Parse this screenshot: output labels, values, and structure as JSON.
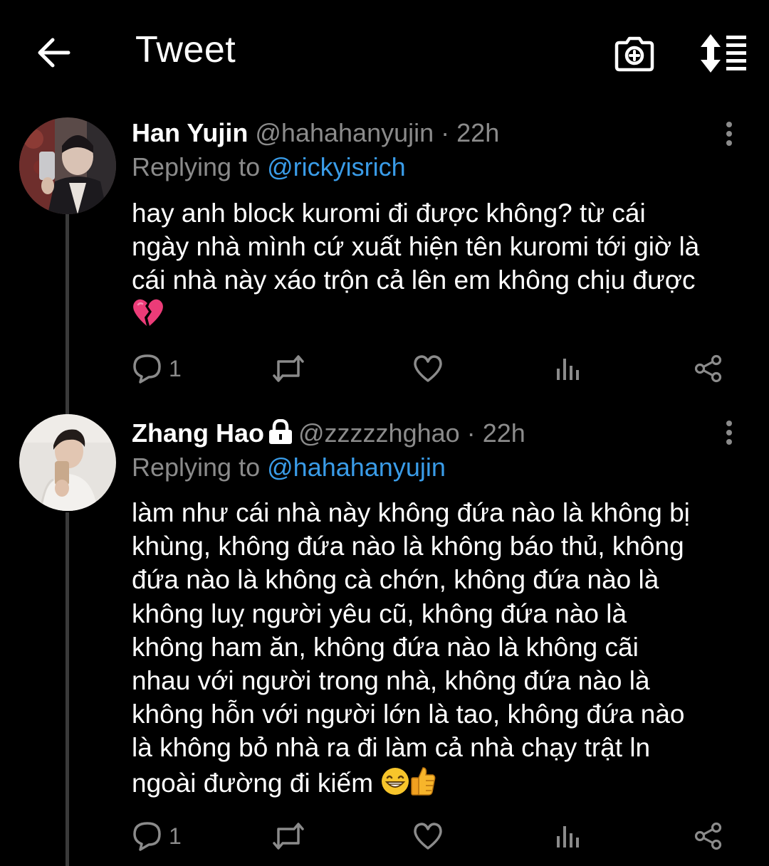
{
  "header": {
    "title": "Tweet",
    "icons": [
      "back-arrow-icon",
      "camera-add-icon",
      "sort-thread-icon"
    ]
  },
  "tweets": [
    {
      "name": "Han Yujin",
      "handle": "@hahahanyujin",
      "separator": "·",
      "time": "22h",
      "replying_prefix": "Replying to",
      "replying_to": "@rickyisrich",
      "text_lines": [
        "hay anh block kuromi đi được không? từ cái",
        "ngày nhà mình cứ xuất hiện tên kuromi tới giờ là",
        "cái nhà này xáo trộn cả lên em không chịu được"
      ],
      "trailing_emoji": "broken-heart-emoji",
      "reply_count": "1",
      "locked": false
    },
    {
      "name": "Zhang Hao",
      "handle": "@zzzzzhghao",
      "separator": "·",
      "time": "22h",
      "replying_prefix": "Replying to",
      "replying_to": "@hahahanyujin",
      "text_lines": [
        "làm như cái nhà này không đứa nào là không bị",
        "khùng, không đứa nào là không báo thủ, không",
        "đứa nào là không cà chớn, không đứa nào là",
        "không luỵ người yêu cũ, không đứa nào là",
        "không ham ăn, không đứa nào là không cãi",
        "nhau với người trong nhà, không đứa nào là",
        "không hỗn với người lớn là tao, không đứa nào",
        "là không bỏ nhà ra đi làm cả nhà chạy trật ln",
        "ngoài đường đi kiếm"
      ],
      "trailing_emoji": "grinning-face-emoji, thumbs-up-emoji",
      "reply_count": "1",
      "locked": true
    }
  ],
  "colors": {
    "background": "#000000",
    "text": "#ffffff",
    "muted": "#8b8b8b",
    "link": "#3a9ce8",
    "thread_line": "#3a3a3a"
  }
}
